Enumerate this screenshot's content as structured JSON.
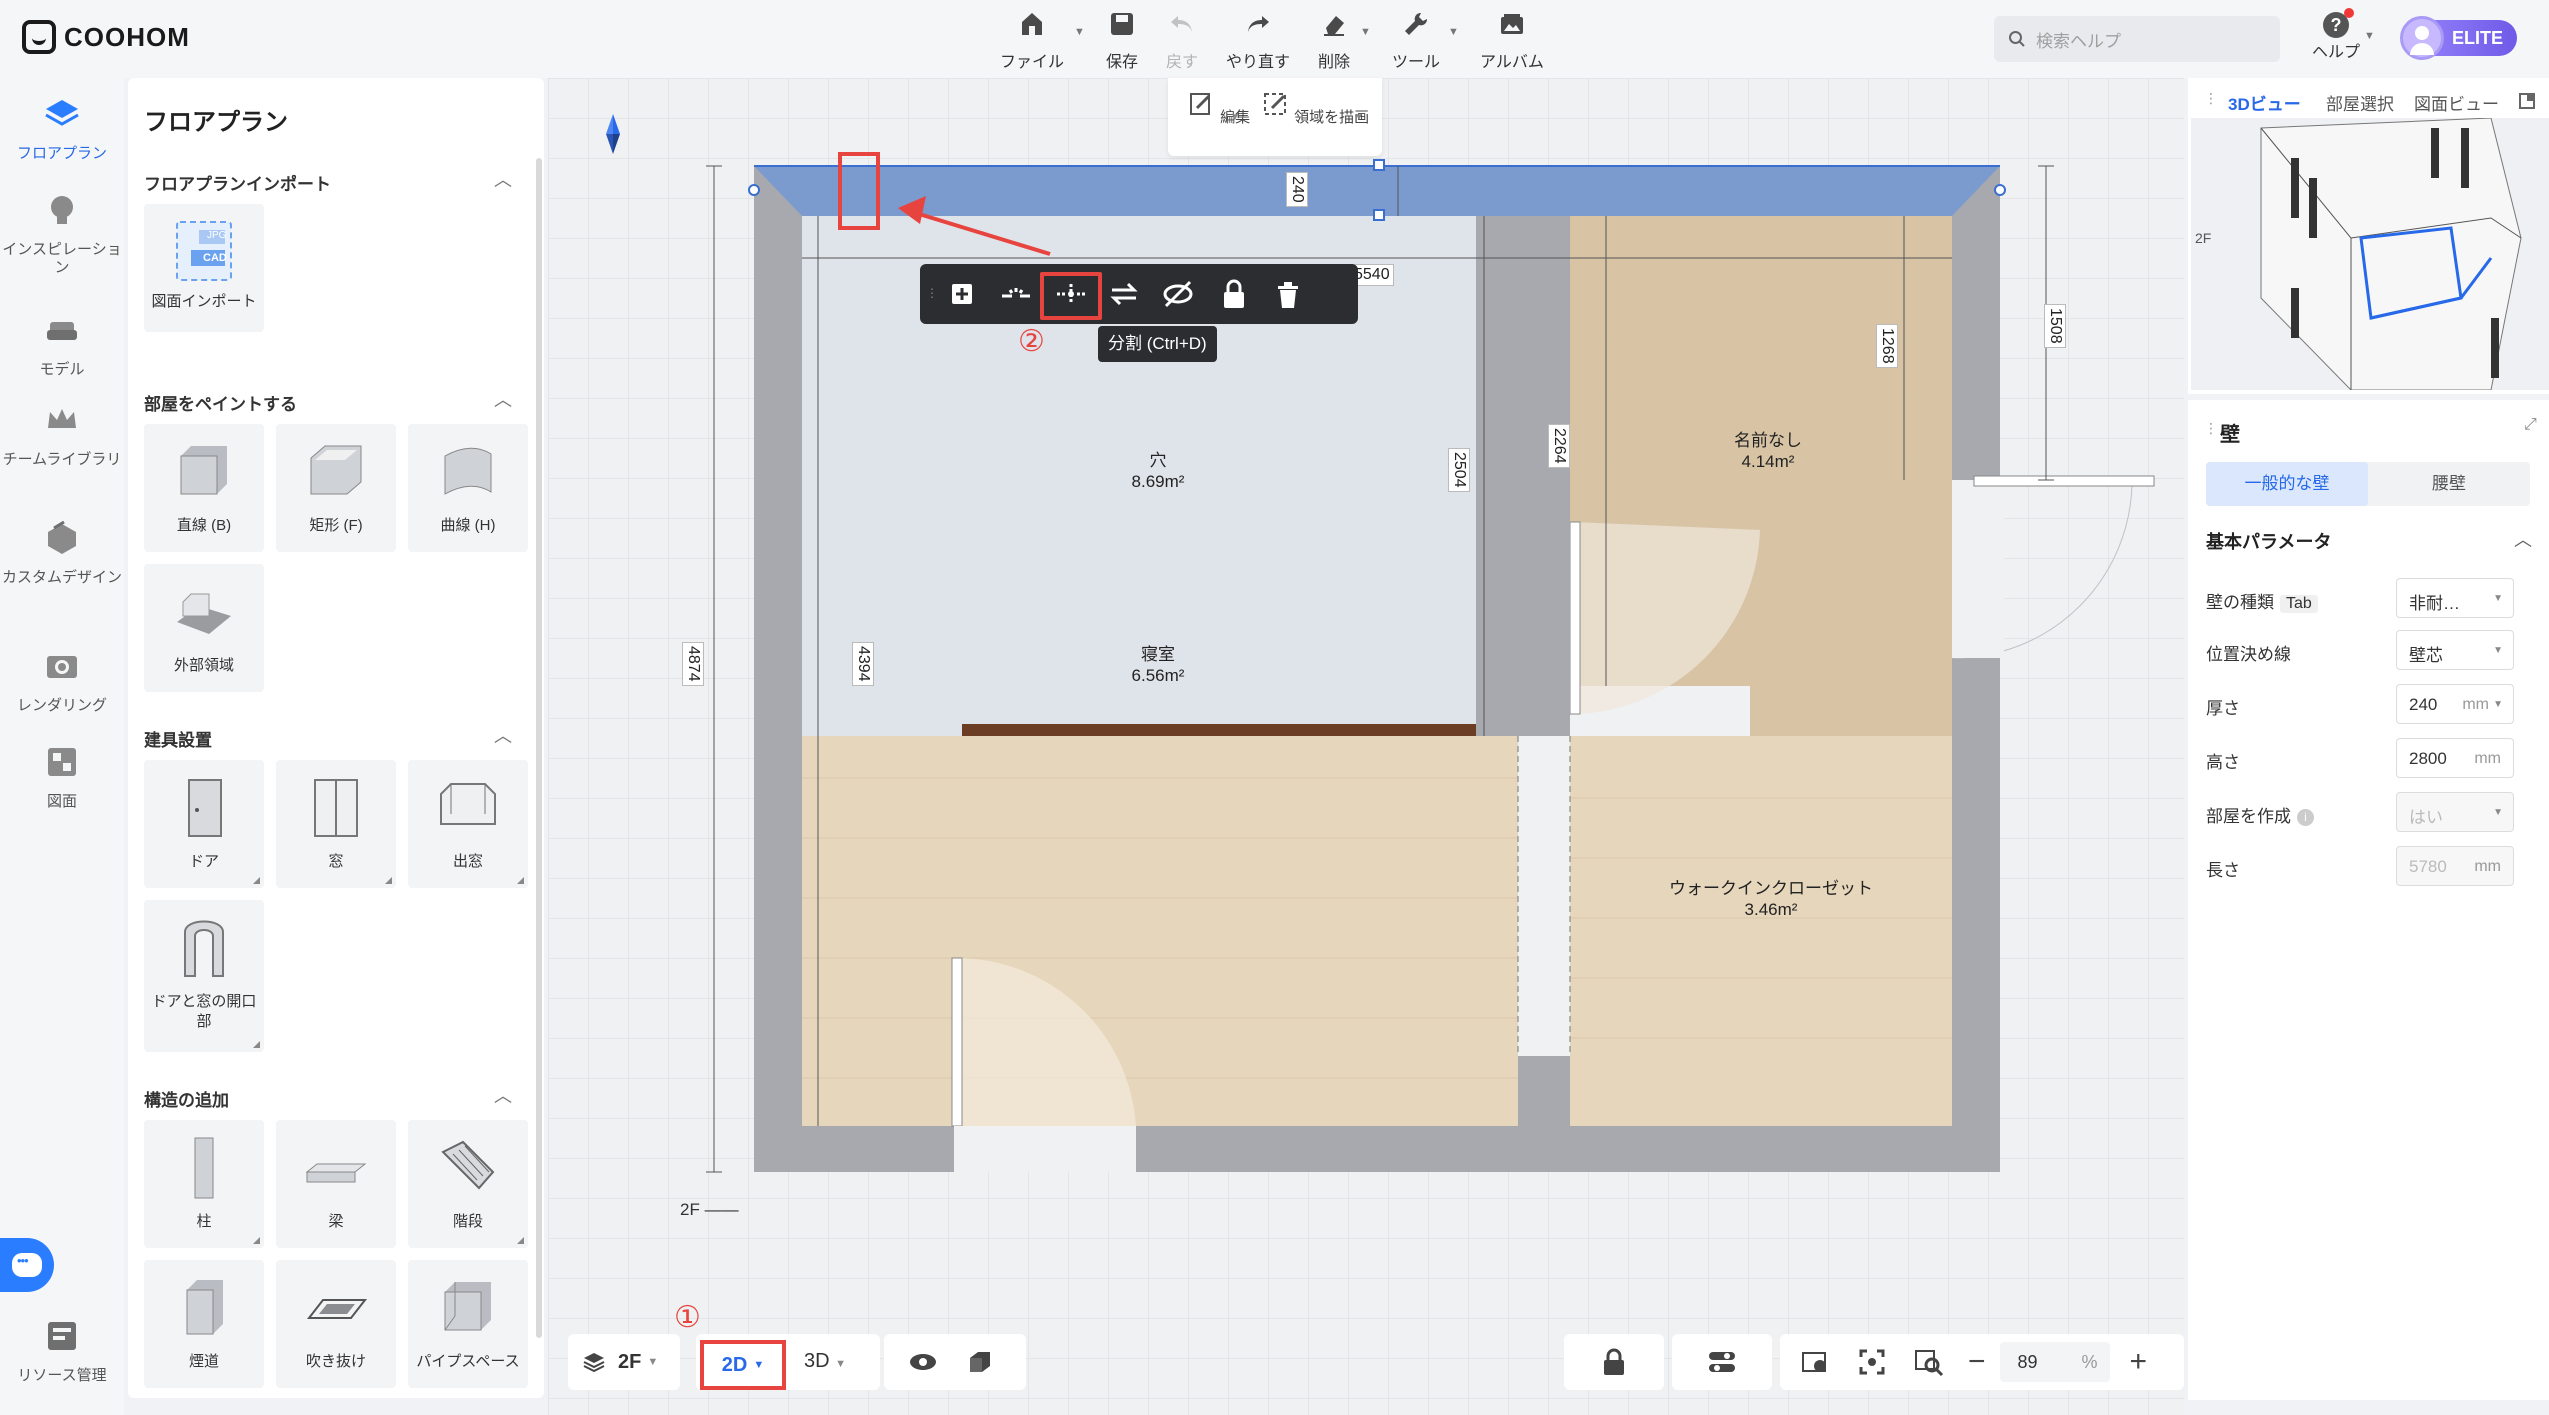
{
  "app": {
    "brand": "COOHOM"
  },
  "toolbar": {
    "file": "ファイル",
    "save": "保存",
    "undo": "戻す",
    "redo": "やり直す",
    "delete": "削除",
    "tools": "ツール",
    "album": "アルバム"
  },
  "search": {
    "placeholder": "検索ヘルプ"
  },
  "help": {
    "label": "ヘルプ"
  },
  "user": {
    "badge": "ELITE"
  },
  "leftnav": [
    {
      "label": "フロアプラン",
      "icon": "floorplan-icon",
      "active": true
    },
    {
      "label": "インスピレーション",
      "icon": "lightbulb-icon"
    },
    {
      "label": "モデル",
      "icon": "sofa-icon"
    },
    {
      "label": "チームライブラリ",
      "icon": "crown-icon"
    },
    {
      "label": "カスタムデザイン",
      "icon": "custom-design-icon"
    },
    {
      "label": "レンダリング",
      "icon": "camera-icon"
    },
    {
      "label": "図面",
      "icon": "drawing-icon"
    },
    {
      "label": "リソース管理",
      "icon": "resource-icon"
    }
  ],
  "panel": {
    "title": "フロアプラン",
    "sections": {
      "import": {
        "title": "フロアプランインポート",
        "tiles": [
          {
            "label": "図面インポート",
            "badge1": "JPG",
            "badge2": "CAD"
          }
        ]
      },
      "paint": {
        "title": "部屋をペイントする",
        "tiles": [
          {
            "label": "直線 (B)"
          },
          {
            "label": "矩形 (F)"
          },
          {
            "label": "曲線 (H)"
          },
          {
            "label": "外部領域"
          }
        ]
      },
      "fixtures": {
        "title": "建具設置",
        "tiles": [
          {
            "label": "ドア"
          },
          {
            "label": "窓"
          },
          {
            "label": "出窓"
          },
          {
            "label": "ドアと窓の開口部"
          }
        ]
      },
      "structure": {
        "title": "構造の追加",
        "tiles": [
          {
            "label": "柱"
          },
          {
            "label": "梁"
          },
          {
            "label": "階段"
          },
          {
            "label": "煙道"
          },
          {
            "label": "吹き抜け"
          },
          {
            "label": "パイプスペース"
          }
        ]
      }
    }
  },
  "canvas": {
    "edit_pop": {
      "edit": "編集",
      "draw_area": "領域を描画"
    },
    "rooms": [
      {
        "name": "穴",
        "area": "8.69m²"
      },
      {
        "name": "寝室",
        "area": "6.56m²"
      },
      {
        "name": "名前なし",
        "area": "4.14m²"
      },
      {
        "name": "ウォークインクローゼット",
        "area": "3.46m²"
      }
    ],
    "dims": {
      "wall_thickness": "240",
      "total_width": "5540",
      "right_height": "1508",
      "closet_dim": "1268",
      "mid": "2504",
      "left_inner": "4394",
      "left_total": "4874",
      "room3": "2264"
    },
    "floor_label": "2F",
    "tooltip": "分割 (Ctrl+D)",
    "marker1": "①",
    "marker2": "②"
  },
  "bottom": {
    "floor": "2F",
    "mode_2d": "2D",
    "mode_3d": "3D",
    "zoom": "89",
    "zoom_unit": "%"
  },
  "right": {
    "tabs": [
      "3Dビュー",
      "部屋選択",
      "図面ビュー"
    ],
    "preview_floor": "2F",
    "title": "壁",
    "seg": [
      "一般的な壁",
      "腰壁"
    ],
    "params_title": "基本パラメータ",
    "params": [
      {
        "label": "壁の種類",
        "tag": "Tab",
        "value": "非耐…",
        "unit": ""
      },
      {
        "label": "位置決め線",
        "value": "壁芯",
        "unit": ""
      },
      {
        "label": "厚さ",
        "value": "240",
        "unit": "mm"
      },
      {
        "label": "高さ",
        "value": "2800",
        "unit": "mm"
      },
      {
        "label": "部屋を作成",
        "value": "はい",
        "unit": ""
      },
      {
        "label": "長さ",
        "value": "5780",
        "unit": "mm"
      }
    ]
  },
  "colors": {
    "accent": "#2769e8",
    "highlight": "#e8443f",
    "wall": "#a9abb0",
    "wood_light": "#e6d6bd",
    "room_blue": "#dde1ea"
  }
}
